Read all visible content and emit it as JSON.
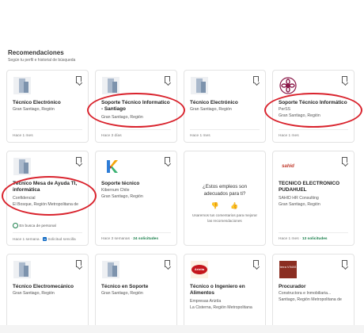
{
  "section": {
    "title": "Recomendaciones",
    "subtitle": "Según tu perfil e historial de búsqueda"
  },
  "cards": [
    {
      "title": "Técnico Electrónico",
      "company": "",
      "location": "Gran Santiago, Región",
      "meta": "Hace 1 mes",
      "logo": "default-logo"
    },
    {
      "title": "Soporte Técnico Informatico - Santiago",
      "company": "",
      "location": "Gran Santiago, Región",
      "meta": "Hace 3 días",
      "logo": "default-logo"
    },
    {
      "title": "Técnico Electrónico",
      "company": "",
      "location": "Gran Santiago, Región",
      "meta": "Hace 1 mes",
      "logo": "default-logo"
    },
    {
      "title": "Soporte Técnico Informático",
      "company": "PerSS",
      "location": "Gran Santiago, Región",
      "meta": "Hace 1 mes",
      "logo": "perss-logo"
    },
    {
      "title": "Técnico Mesa de Ayuda TI, informática",
      "company": "Confidencial",
      "location": "El Bosque, Región Metropolitana de",
      "meta": "Hace 1 semana · ",
      "meta_easy": "Solicitud sencilla",
      "hiring": "En busca de personal",
      "logo": "default-logo"
    },
    {
      "title": "Soporte técnico",
      "company": "Kibernum Chile",
      "location": "Gran Santiago, Región",
      "meta": "Hace 3 semanas · ",
      "meta_green": "24 solicitudes",
      "logo": "kibernum-logo"
    },
    {
      "question": "¿Estos empleos son adecuados para ti?",
      "note": "Usaremos tus comentarios para mejorar las recomendaciones"
    },
    {
      "title": "TECNICO ELECTRONICO PUDAHUEL",
      "company": "SAHID HR Consulting",
      "location": "Gran Santiago, Región",
      "meta": "Hace 1 mes · ",
      "meta_green": "13 solicitudes",
      "logo": "sahid-logo",
      "logo_text": "sahid"
    },
    {
      "title": "Técnico Electromecánico",
      "company": "",
      "location": "Gran Santiago, Región",
      "meta": "",
      "logo": "default-logo"
    },
    {
      "title": "Técnico en Soporte",
      "company": "",
      "location": "Gran Santiago, Región",
      "meta": "",
      "logo": "default-logo"
    },
    {
      "title": "Técnico o Ingeniero en Alimentos",
      "company": "Empresas Ariztía",
      "location": "La Cisterna, Región Metropolitana",
      "meta": "",
      "logo": "ariztia-logo",
      "logo_text": "Ariztía"
    },
    {
      "title": "Procurador",
      "company": "Constructora e Inmobiliaria...",
      "location": "Santiago, Región Metropolitana de",
      "meta": "",
      "logo": "terra-logo",
      "logo_text": "terra VIVAS"
    }
  ],
  "feedback": {
    "thumbs_down": "👎",
    "thumbs_up": "👍"
  },
  "colors": {
    "annotation": "#d9232d",
    "green": "#1a7f4b",
    "accent": "#0a66c2"
  }
}
